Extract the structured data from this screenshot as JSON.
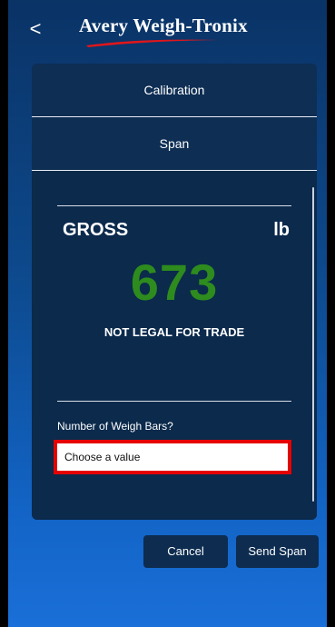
{
  "header": {
    "back_glyph": "<",
    "brand": "Avery Weigh-Tronix",
    "brand_accent_color": "#e0161b"
  },
  "menu": {
    "items": [
      {
        "label": "Calibration"
      },
      {
        "label": "Span"
      }
    ]
  },
  "scale": {
    "mode": "GROSS",
    "unit": "lb",
    "weight": "673",
    "weight_color": "#2e8b1e",
    "legal_notice": "NOT LEGAL FOR TRADE"
  },
  "form": {
    "question": "Number of Weigh Bars?",
    "select_value": "Choose a value",
    "highlight_color": "#e60000"
  },
  "actions": {
    "cancel_label": "Cancel",
    "send_span_label": "Send Span"
  }
}
